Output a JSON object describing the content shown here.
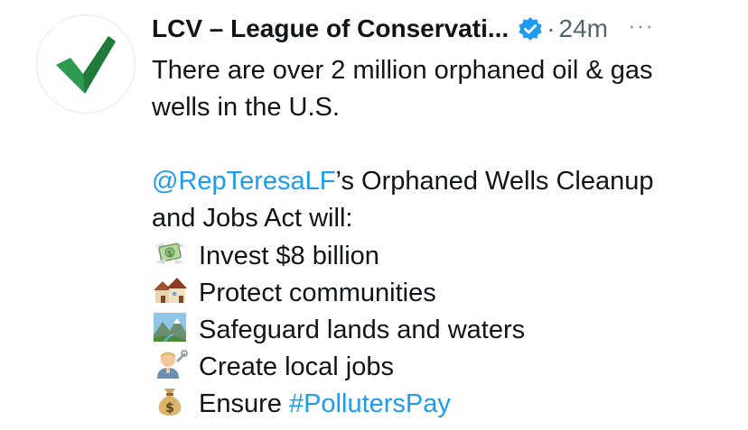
{
  "account": {
    "display_name": "LCV – League of Conservati...",
    "verified_icon": "verified-badge-icon",
    "separator": "·",
    "timestamp": "24m",
    "more_label": "···"
  },
  "colors": {
    "link": "#1d9bf0",
    "text": "#0f1419",
    "muted": "#536471",
    "avatar_check": "#2e9a4f"
  },
  "tweet": {
    "intro_line_1": "There are over 2 million orphaned oil & gas",
    "intro_line_2": "wells in the U.S.",
    "mention": "@RepTeresaLF",
    "mention_suffix": "’s Orphaned Wells Cleanup",
    "act_line": "and Jobs Act will:",
    "bullets": [
      {
        "icon": "money-with-wings-icon",
        "text": "Invest $8 billion"
      },
      {
        "icon": "houses-icon",
        "text": "Protect communities"
      },
      {
        "icon": "national-park-icon",
        "text": "Safeguard lands and waters"
      },
      {
        "icon": "mechanic-icon",
        "text": "Create local jobs"
      },
      {
        "icon": "money-bag-icon",
        "text": "Ensure "
      }
    ],
    "hashtag": "#PollutersPay"
  }
}
